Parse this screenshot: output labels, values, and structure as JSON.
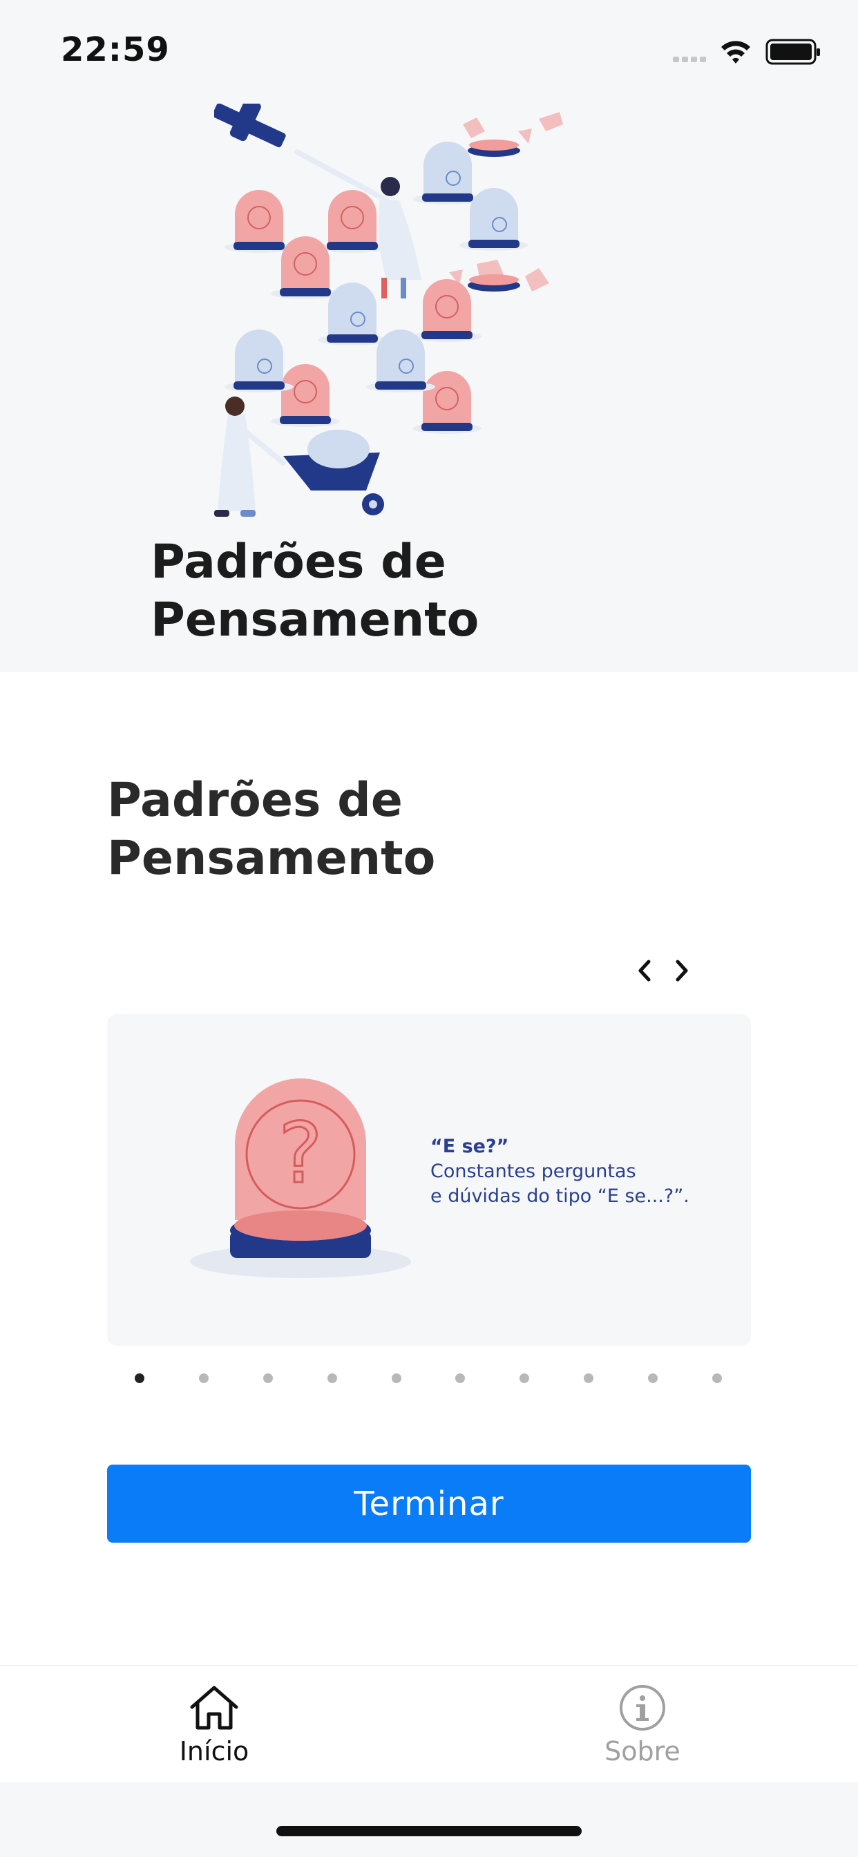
{
  "status_bar": {
    "time": "22:59",
    "icons": [
      "signal-icon",
      "wifi-icon",
      "battery-icon"
    ]
  },
  "hero": {
    "title_line1": "Padrões de",
    "title_line2": "Pensamento",
    "illustration": "hero-illustration"
  },
  "content": {
    "title_line1": "Padrões de",
    "title_line2": "Pensamento",
    "nav_icons": [
      "chevron-left-icon",
      "chevron-right-icon"
    ],
    "card": {
      "heading": "“E se?”",
      "description_line1": "Constantes perguntas",
      "description_line2": "e dúvidas do tipo “E se...?”.",
      "illustration": "question-dome-illustration"
    },
    "pagination": {
      "count": 10,
      "active_index": 0
    },
    "button_label": "Terminar"
  },
  "tabbar": {
    "tabs": [
      {
        "label": "Início",
        "icon": "home-icon",
        "active": true
      },
      {
        "label": "Sobre",
        "icon": "info-icon",
        "active": false
      }
    ]
  },
  "colors": {
    "primary": "#0a7cf7",
    "dome_red": "#f0a0a0",
    "dome_blue": "#c8d6eb",
    "navy": "#22398a",
    "tab_active": "#111111",
    "tab_inactive": "#a0a0a0"
  }
}
